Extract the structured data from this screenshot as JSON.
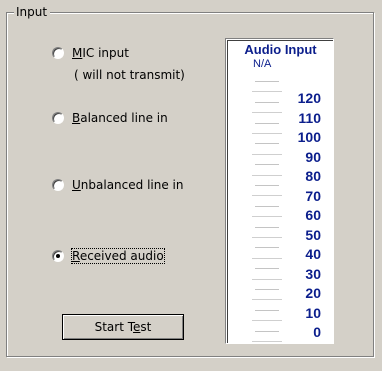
{
  "group": {
    "title": "Input"
  },
  "options": {
    "mic": {
      "mnemonic": "M",
      "rest": "IC input",
      "sublabel": "( will not transmit)",
      "selected": false
    },
    "balanced": {
      "mnemonic": "B",
      "rest": "alanced line in",
      "selected": false
    },
    "unbalanced": {
      "mnemonic": "U",
      "rest": "nbalanced line in",
      "selected": false
    },
    "received": {
      "mnemonic": "R",
      "rest": "eceived audio",
      "selected": true
    }
  },
  "button": {
    "start_test_prefix": "Start T",
    "start_test_mnemonic": "e",
    "start_test_suffix": "st"
  },
  "meter": {
    "title": "Audio Input",
    "status": "N/A",
    "scale": [
      "120",
      "110",
      "100",
      "90",
      "80",
      "70",
      "60",
      "50",
      "40",
      "30",
      "20",
      "10",
      "0"
    ],
    "colors": {
      "label": "#0b1e8c"
    }
  }
}
